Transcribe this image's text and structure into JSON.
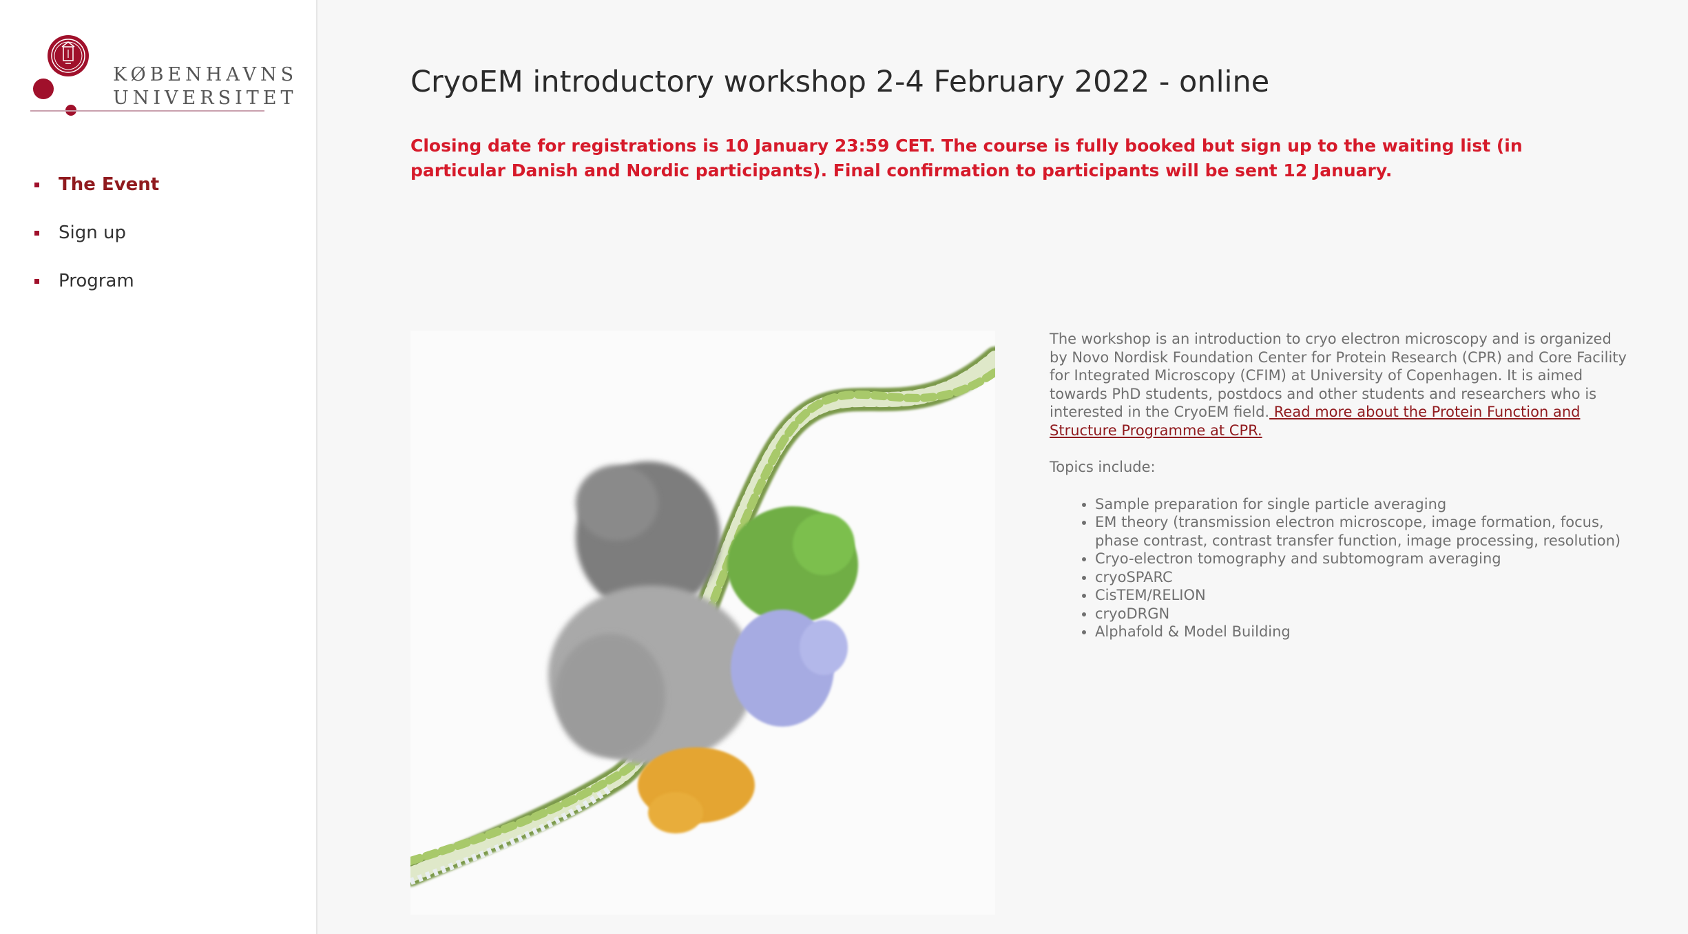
{
  "logo": {
    "line1": "KØBENHAVNS",
    "line2": "UNIVERSITET",
    "brand_color": "#a0102b"
  },
  "nav": {
    "items": [
      {
        "label": "The Event",
        "active": true
      },
      {
        "label": "Sign up",
        "active": false
      },
      {
        "label": "Program",
        "active": false
      }
    ],
    "active_color": "#901a1e"
  },
  "main": {
    "title": "CryoEM introductory workshop 2-4 February 2022 - online",
    "notice": "Closing date for registrations is 10 January 23:59 CET. The course is fully booked but sign up to the waiting list (in particular Danish and Nordic participants). Final confirmation to participants will be sent 12 January.",
    "notice_color": "#d61a2a",
    "hero_image": "cryoem-protein-dna-complex-illustration",
    "description": "The workshop is an introduction to cryo electron microscopy and is organized by Novo Nordisk Foundation Center for Protein Research (CPR) and Core Facility for Integrated Microscopy (CFIM) at University of Copenhagen. It is aimed towards PhD students, postdocs and other students and  researchers who is interested in the CryoEM field.",
    "read_more_link": " Read more about the Protein Function and Structure Programme at CPR.",
    "topics_heading": "Topics include:",
    "topics": [
      "Sample preparation for single particle averaging",
      "EM theory (transmission electron microscope, image formation, focus, phase contrast, contrast transfer function, image processing, resolution)",
      "Cryo-electron tomography and subtomogram averaging",
      "cryoSPARC",
      "CisTEM/RELION",
      "cryoDRGN",
      "Alphafold & Model Building"
    ]
  }
}
